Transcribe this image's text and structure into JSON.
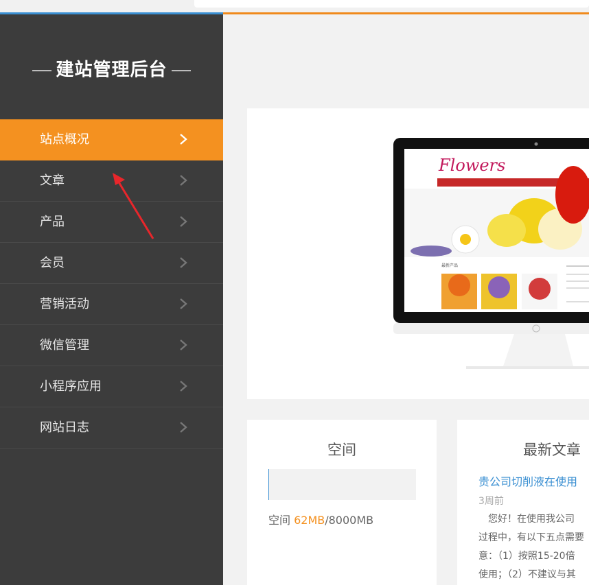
{
  "sidebar": {
    "title": "建站管理后台",
    "items": [
      {
        "label": "站点概况",
        "active": true
      },
      {
        "label": "文章",
        "active": false
      },
      {
        "label": "产品",
        "active": false
      },
      {
        "label": "会员",
        "active": false
      },
      {
        "label": "营销活动",
        "active": false
      },
      {
        "label": "微信管理",
        "active": false
      },
      {
        "label": "小程序应用",
        "active": false
      },
      {
        "label": "网站日志",
        "active": false
      }
    ]
  },
  "monitor_preview": {
    "logo_text": "Flowers",
    "section_label": "最新产品"
  },
  "space_card": {
    "title": "空间",
    "prefix": "空间 ",
    "used": "62MB",
    "total": "/8000MB"
  },
  "news_card": {
    "title": "最新文章",
    "article_title": "贵公司切削液在使用",
    "time": "3周前",
    "excerpt": [
      "　您好！在使用我公司",
      "过程中，有以下五点需要",
      "意：（1）按照15-20倍",
      "使用；（2）不建议与其"
    ]
  },
  "colors": {
    "accent": "#f49120",
    "sidebar_bg": "#3c3c3c",
    "link": "#3a8fd2"
  }
}
